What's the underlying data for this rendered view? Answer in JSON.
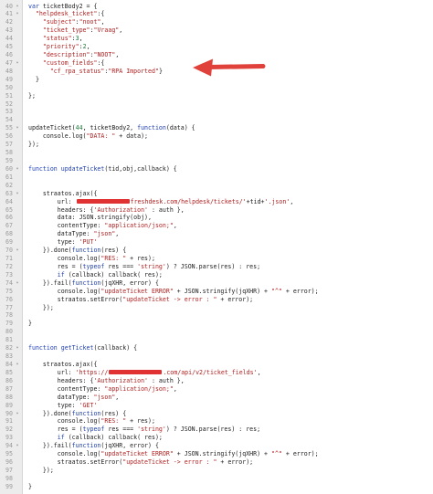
{
  "editor": {
    "lines": [
      {
        "n": "40",
        "fold": "▾",
        "segs": [
          [
            "kw",
            "var "
          ],
          [
            "p",
            "ticketBody2 = {"
          ]
        ]
      },
      {
        "n": "41",
        "fold": "▾",
        "segs": [
          [
            "p",
            "  "
          ],
          [
            "str",
            "\"helpdesk_ticket\""
          ],
          [
            "p",
            ":{"
          ]
        ]
      },
      {
        "n": "42",
        "fold": "",
        "segs": [
          [
            "p",
            "    "
          ],
          [
            "str",
            "\"subject\""
          ],
          [
            "p",
            ":"
          ],
          [
            "str",
            "\"noot\""
          ],
          [
            "p",
            ","
          ]
        ]
      },
      {
        "n": "43",
        "fold": "",
        "segs": [
          [
            "p",
            "    "
          ],
          [
            "str",
            "\"ticket_type\""
          ],
          [
            "p",
            ":"
          ],
          [
            "str",
            "\"Vraag\""
          ],
          [
            "p",
            ","
          ]
        ]
      },
      {
        "n": "44",
        "fold": "",
        "segs": [
          [
            "p",
            "    "
          ],
          [
            "str",
            "\"status\""
          ],
          [
            "p",
            ":"
          ],
          [
            "num",
            "3"
          ],
          [
            "p",
            ","
          ]
        ]
      },
      {
        "n": "45",
        "fold": "",
        "segs": [
          [
            "p",
            "    "
          ],
          [
            "str",
            "\"priority\""
          ],
          [
            "p",
            ":"
          ],
          [
            "num",
            "2"
          ],
          [
            "p",
            ","
          ]
        ]
      },
      {
        "n": "46",
        "fold": "",
        "segs": [
          [
            "p",
            "    "
          ],
          [
            "str",
            "\"description\""
          ],
          [
            "p",
            ":"
          ],
          [
            "str",
            "\"NOOT\""
          ],
          [
            "p",
            ","
          ]
        ]
      },
      {
        "n": "47",
        "fold": "▾",
        "segs": [
          [
            "p",
            "    "
          ],
          [
            "str",
            "\"custom_fields\""
          ],
          [
            "p",
            ":{"
          ]
        ]
      },
      {
        "n": "48",
        "fold": "",
        "segs": [
          [
            "p",
            "      "
          ],
          [
            "str",
            "\"cf_rpa_status\""
          ],
          [
            "p",
            ":"
          ],
          [
            "str",
            "\"RPA Imported\""
          ],
          [
            "p",
            "}"
          ]
        ]
      },
      {
        "n": "49",
        "fold": "",
        "segs": [
          [
            "p",
            "  }"
          ]
        ]
      },
      {
        "n": "50",
        "fold": "",
        "segs": []
      },
      {
        "n": "51",
        "fold": "",
        "segs": [
          [
            "p",
            "};"
          ]
        ]
      },
      {
        "n": "52",
        "fold": "",
        "segs": []
      },
      {
        "n": "53",
        "fold": "",
        "segs": []
      },
      {
        "n": "54",
        "fold": "",
        "segs": []
      },
      {
        "n": "55",
        "fold": "▾",
        "segs": [
          [
            "p",
            "updateTicket("
          ],
          [
            "num",
            "44"
          ],
          [
            "p",
            ", ticketBody2, "
          ],
          [
            "kw",
            "function"
          ],
          [
            "p",
            "(data) {"
          ]
        ]
      },
      {
        "n": "56",
        "fold": "",
        "segs": [
          [
            "p",
            "    console.log("
          ],
          [
            "str",
            "\"DATA: \""
          ],
          [
            "p",
            " + data);"
          ]
        ]
      },
      {
        "n": "57",
        "fold": "",
        "segs": [
          [
            "p",
            "});"
          ]
        ]
      },
      {
        "n": "58",
        "fold": "",
        "segs": []
      },
      {
        "n": "59",
        "fold": "",
        "segs": []
      },
      {
        "n": "60",
        "fold": "▾",
        "segs": [
          [
            "kw",
            "function "
          ],
          [
            "fn",
            "updateTicket"
          ],
          [
            "p",
            "(tid,obj,callback) {"
          ]
        ]
      },
      {
        "n": "61",
        "fold": "",
        "segs": []
      },
      {
        "n": "62",
        "fold": "",
        "segs": []
      },
      {
        "n": "63",
        "fold": "▾",
        "segs": [
          [
            "p",
            "    straatos.ajax({"
          ]
        ]
      },
      {
        "n": "64",
        "fold": "",
        "segs": [
          [
            "p",
            "        url: "
          ],
          [
            "redact",
            ""
          ],
          [
            "str",
            "freshdesk.com/helpdesk/tickets/'"
          ],
          [
            "p",
            "+tid+"
          ],
          [
            "str",
            "'.json'"
          ],
          [
            "p",
            ","
          ]
        ]
      },
      {
        "n": "65",
        "fold": "",
        "segs": [
          [
            "p",
            "        headers: {"
          ],
          [
            "str",
            "'Authorization'"
          ],
          [
            "p",
            " : auth },"
          ]
        ]
      },
      {
        "n": "66",
        "fold": "",
        "segs": [
          [
            "p",
            "        data: JSON.stringify(obj),"
          ]
        ]
      },
      {
        "n": "67",
        "fold": "",
        "segs": [
          [
            "p",
            "        contentType: "
          ],
          [
            "str",
            "\"application/json;\""
          ],
          [
            "p",
            ","
          ]
        ]
      },
      {
        "n": "68",
        "fold": "",
        "segs": [
          [
            "p",
            "        dataType: "
          ],
          [
            "str",
            "\"json\""
          ],
          [
            "p",
            ","
          ]
        ]
      },
      {
        "n": "69",
        "fold": "",
        "segs": [
          [
            "p",
            "        type: "
          ],
          [
            "str",
            "'PUT'"
          ]
        ]
      },
      {
        "n": "70",
        "fold": "▾",
        "segs": [
          [
            "p",
            "    }).done("
          ],
          [
            "kw",
            "function"
          ],
          [
            "p",
            "(res) {"
          ]
        ]
      },
      {
        "n": "71",
        "fold": "",
        "segs": [
          [
            "p",
            "        console.log("
          ],
          [
            "str",
            "\"RES: \""
          ],
          [
            "p",
            " + res);"
          ]
        ]
      },
      {
        "n": "72",
        "fold": "",
        "segs": [
          [
            "p",
            "        res = ("
          ],
          [
            "kw",
            "typeof"
          ],
          [
            "p",
            " res === "
          ],
          [
            "str",
            "'string'"
          ],
          [
            "p",
            ") ? JSON.parse(res) : res;"
          ]
        ]
      },
      {
        "n": "73",
        "fold": "",
        "segs": [
          [
            "p",
            "        "
          ],
          [
            "kw",
            "if"
          ],
          [
            "p",
            " (callback) callback( res);"
          ]
        ]
      },
      {
        "n": "74",
        "fold": "▾",
        "segs": [
          [
            "p",
            "    }).fail("
          ],
          [
            "kw",
            "function"
          ],
          [
            "p",
            "(jqXHR, error) {"
          ]
        ]
      },
      {
        "n": "75",
        "fold": "",
        "segs": [
          [
            "p",
            "        console.log("
          ],
          [
            "str",
            "\"updateTicket ERROR\""
          ],
          [
            "p",
            " + JSON.stringify(jqXHR) + "
          ],
          [
            "str",
            "\"^\""
          ],
          [
            "p",
            " + error);"
          ]
        ]
      },
      {
        "n": "76",
        "fold": "",
        "segs": [
          [
            "p",
            "        straatos.setError("
          ],
          [
            "str",
            "\"updateTicket -> error : \""
          ],
          [
            "p",
            " + error);"
          ]
        ]
      },
      {
        "n": "77",
        "fold": "",
        "segs": [
          [
            "p",
            "    });"
          ]
        ]
      },
      {
        "n": "78",
        "fold": "",
        "segs": []
      },
      {
        "n": "79",
        "fold": "",
        "segs": [
          [
            "p",
            "}"
          ]
        ]
      },
      {
        "n": "80",
        "fold": "",
        "segs": []
      },
      {
        "n": "81",
        "fold": "",
        "segs": []
      },
      {
        "n": "82",
        "fold": "▾",
        "segs": [
          [
            "kw",
            "function "
          ],
          [
            "fn",
            "getTicket"
          ],
          [
            "p",
            "(callback) {"
          ]
        ]
      },
      {
        "n": "83",
        "fold": "",
        "segs": []
      },
      {
        "n": "84",
        "fold": "▾",
        "segs": [
          [
            "p",
            "    straatos.ajax({"
          ]
        ]
      },
      {
        "n": "85",
        "fold": "",
        "segs": [
          [
            "p",
            "        url: "
          ],
          [
            "str",
            "'https://"
          ],
          [
            "redact",
            ""
          ],
          [
            "str",
            ".com/api/v2/ticket_fields'"
          ],
          [
            "p",
            ","
          ]
        ]
      },
      {
        "n": "86",
        "fold": "",
        "segs": [
          [
            "p",
            "        headers: {"
          ],
          [
            "str",
            "'Authorization'"
          ],
          [
            "p",
            " : auth },"
          ]
        ]
      },
      {
        "n": "87",
        "fold": "",
        "segs": [
          [
            "p",
            "        contentType: "
          ],
          [
            "str",
            "\"application/json;\""
          ],
          [
            "p",
            ","
          ]
        ]
      },
      {
        "n": "88",
        "fold": "",
        "segs": [
          [
            "p",
            "        dataType: "
          ],
          [
            "str",
            "\"json\""
          ],
          [
            "p",
            ","
          ]
        ]
      },
      {
        "n": "89",
        "fold": "",
        "segs": [
          [
            "p",
            "        type: "
          ],
          [
            "str",
            "'GET'"
          ]
        ]
      },
      {
        "n": "90",
        "fold": "▾",
        "segs": [
          [
            "p",
            "    }).done("
          ],
          [
            "kw",
            "function"
          ],
          [
            "p",
            "(res) {"
          ]
        ]
      },
      {
        "n": "91",
        "fold": "",
        "segs": [
          [
            "p",
            "        console.log("
          ],
          [
            "str",
            "\"RES: \""
          ],
          [
            "p",
            " + res);"
          ]
        ]
      },
      {
        "n": "92",
        "fold": "",
        "segs": [
          [
            "p",
            "        res = ("
          ],
          [
            "kw",
            "typeof"
          ],
          [
            "p",
            " res === "
          ],
          [
            "str",
            "'string'"
          ],
          [
            "p",
            ") ? JSON.parse(res) : res;"
          ]
        ]
      },
      {
        "n": "93",
        "fold": "",
        "segs": [
          [
            "p",
            "        "
          ],
          [
            "kw",
            "if"
          ],
          [
            "p",
            " (callback) callback( res);"
          ]
        ]
      },
      {
        "n": "94",
        "fold": "▾",
        "segs": [
          [
            "p",
            "    }).fail("
          ],
          [
            "kw",
            "function"
          ],
          [
            "p",
            "(jqXHR, error) {"
          ]
        ]
      },
      {
        "n": "95",
        "fold": "",
        "segs": [
          [
            "p",
            "        console.log("
          ],
          [
            "str",
            "\"updateTicket ERROR\""
          ],
          [
            "p",
            " + JSON.stringify(jqXHR) + "
          ],
          [
            "str",
            "\"^\""
          ],
          [
            "p",
            " + error);"
          ]
        ]
      },
      {
        "n": "96",
        "fold": "",
        "segs": [
          [
            "p",
            "        straatos.setError("
          ],
          [
            "str",
            "\"updateTicket -> error : \""
          ],
          [
            "p",
            " + error);"
          ]
        ]
      },
      {
        "n": "97",
        "fold": "",
        "segs": [
          [
            "p",
            "    });"
          ]
        ]
      },
      {
        "n": "98",
        "fold": "",
        "segs": []
      },
      {
        "n": "99",
        "fold": "",
        "segs": [
          [
            "p",
            "}"
          ]
        ]
      }
    ]
  },
  "annotation": {
    "arrow_icon": "red-arrow-icon",
    "arrow_color": "#e0413a"
  },
  "colors": {
    "keyword": "#1f3fb0",
    "string": "#b22222",
    "number": "#1f7a3a",
    "redaction": "#e03232"
  }
}
